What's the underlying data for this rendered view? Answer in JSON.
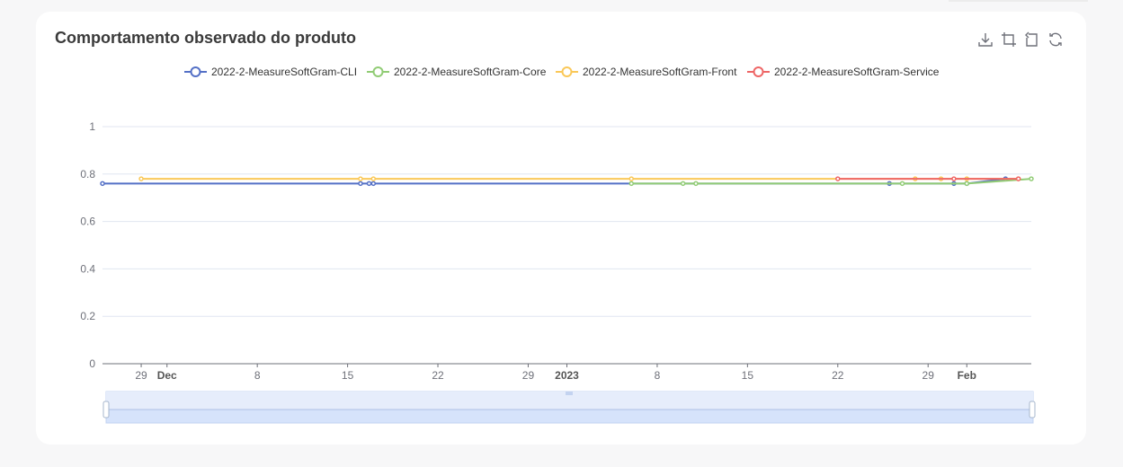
{
  "card": {
    "title": "Comportamento observado do produto"
  },
  "toolbar": [
    "download-icon",
    "zoom-select-icon",
    "zoom-reset-icon",
    "restore-icon"
  ],
  "chart_data": {
    "type": "line",
    "title": "Comportamento observado do produto",
    "xlabel": "",
    "ylabel": "",
    "xlim": [
      "2022-11-26",
      "2023-02-06"
    ],
    "ylim": [
      0,
      1
    ],
    "grid": true,
    "legend_position": "top",
    "data_zoom_slider": true,
    "y_ticks": [
      "0",
      "0.2",
      "0.4",
      "0.6",
      "0.8",
      "1"
    ],
    "x_ticks": [
      {
        "date": "2022-11-29",
        "label": "29",
        "bold": false
      },
      {
        "date": "2022-12-01",
        "label": "Dec",
        "bold": true
      },
      {
        "date": "2022-12-08",
        "label": "8",
        "bold": false
      },
      {
        "date": "2022-12-15",
        "label": "15",
        "bold": false
      },
      {
        "date": "2022-12-22",
        "label": "22",
        "bold": false
      },
      {
        "date": "2022-12-29",
        "label": "29",
        "bold": false
      },
      {
        "date": "2023-01-01",
        "label": "2023",
        "bold": true
      },
      {
        "date": "2023-01-08",
        "label": "8",
        "bold": false
      },
      {
        "date": "2023-01-15",
        "label": "15",
        "bold": false
      },
      {
        "date": "2023-01-22",
        "label": "22",
        "bold": false
      },
      {
        "date": "2023-01-29",
        "label": "29",
        "bold": false
      },
      {
        "date": "2023-02-01",
        "label": "Feb",
        "bold": true
      }
    ],
    "series": [
      {
        "name": "2022-2-MeasureSoftGram-CLI",
        "color": "#5470c6",
        "points": [
          [
            "2022-11-26",
            0.76
          ],
          [
            "2022-12-16",
            0.76
          ],
          [
            "2022-12-16 16:00",
            0.76
          ],
          [
            "2022-12-17",
            0.76
          ],
          [
            "2023-01-26",
            0.76
          ],
          [
            "2023-01-31",
            0.76
          ],
          [
            "2023-02-01",
            0.76
          ],
          [
            "2023-02-04",
            0.78
          ]
        ]
      },
      {
        "name": "2022-2-MeasureSoftGram-Core",
        "color": "#91cc75",
        "points": [
          [
            "2023-01-06",
            0.76
          ],
          [
            "2023-01-10",
            0.76
          ],
          [
            "2023-01-11",
            0.76
          ],
          [
            "2023-01-27",
            0.76
          ],
          [
            "2023-02-01",
            0.76
          ],
          [
            "2023-02-06",
            0.78
          ]
        ]
      },
      {
        "name": "2022-2-MeasureSoftGram-Front",
        "color": "#fac858",
        "points": [
          [
            "2022-11-29",
            0.78
          ],
          [
            "2022-12-16",
            0.78
          ],
          [
            "2022-12-17",
            0.78
          ],
          [
            "2023-01-06",
            0.78
          ],
          [
            "2023-01-28",
            0.78
          ],
          [
            "2023-01-30",
            0.78
          ],
          [
            "2023-02-01",
            0.78
          ],
          [
            "2023-02-05",
            0.78
          ]
        ]
      },
      {
        "name": "2022-2-MeasureSoftGram-Service",
        "color": "#ee6666",
        "points": [
          [
            "2023-01-22",
            0.78
          ],
          [
            "2023-01-31",
            0.78
          ],
          [
            "2023-02-05",
            0.78
          ]
        ]
      }
    ]
  }
}
